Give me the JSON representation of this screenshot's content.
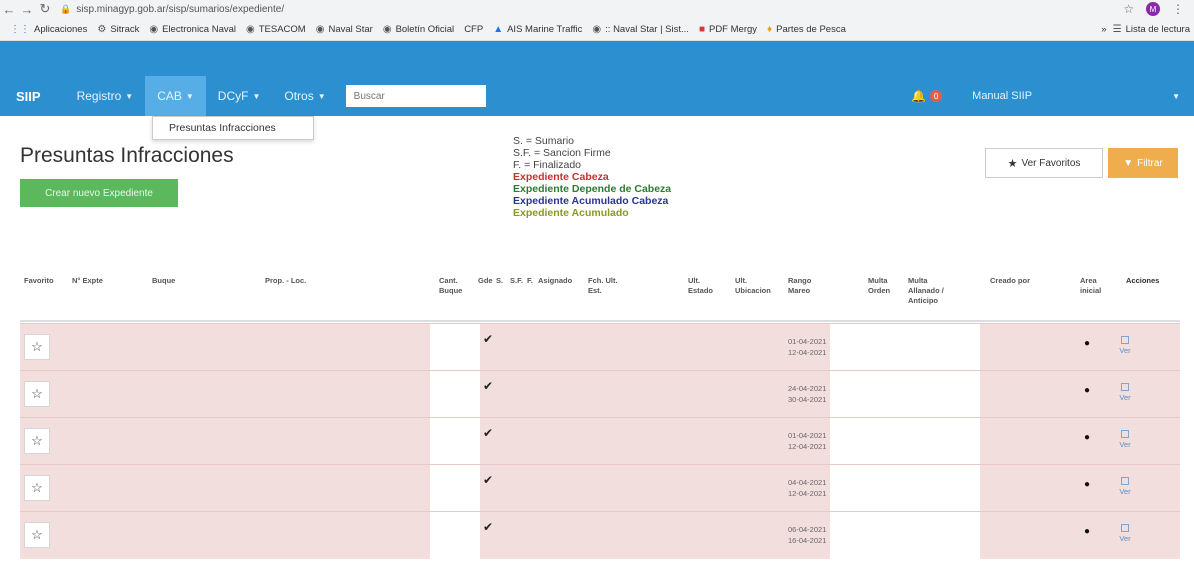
{
  "browser": {
    "url": "sisp.minagyp.gob.ar/sisp/sumarios/expediente/",
    "profile_initial": "M",
    "bookmarks": [
      "Aplicaciones",
      "Sitrack",
      "Electronica Naval",
      "TESACOM",
      "Naval Star",
      "Boletín Oficial",
      "CFP",
      "AIS Marine Traffic",
      ":: Naval Star | Sist...",
      "PDF Mergy",
      "Partes de Pesca"
    ],
    "reading_list": "Lista de lectura"
  },
  "navbar": {
    "brand": "SIIP",
    "menus": [
      "Registro",
      "CAB",
      "DCyF",
      "Otros"
    ],
    "search_placeholder": "Buscar",
    "notification_count": "0",
    "user_label": "Manual SIIP"
  },
  "dropdown": {
    "item": "Presuntas Infracciones"
  },
  "page": {
    "title": "Presuntas Infracciones",
    "create_button": "Crear nuevo Expediente",
    "favorites_button": "Ver Favoritos",
    "filter_button": "Filtrar"
  },
  "legend": {
    "sumario": "S. = Sumario",
    "sancion": "S.F. = Sancion Firme",
    "finalizado": "F. = Finalizado",
    "cabeza": "Expediente Cabeza",
    "depende": "Expediente Depende de Cabeza",
    "acumulado_cabeza": "Expediente Acumulado Cabeza",
    "acumulado": "Expediente Acumulado",
    "colors": {
      "cabeza": "#c9302c",
      "depende": "#2d7a32",
      "acumulado_cabeza": "#283593",
      "acumulado": "#8a9a20"
    }
  },
  "table": {
    "headers": {
      "favorito": "Favorito",
      "nro_expte": "N° Expte",
      "buque": "Buque",
      "prop_loc": "Prop. - Loc.",
      "cant_buque": "Cant. Buque",
      "gde": "Gde",
      "s": "S.",
      "sf": "S.F.",
      "f": "F.",
      "asignado": "Asignado",
      "fch_ult_est": "Fch. Ult. Est.",
      "ult_estado": "Ult. Estado",
      "ult_ubicacion": "Ult. Ubicacion",
      "rango_mareo": "Rango Mareo",
      "multa_orden": "Multa Orden",
      "multa_allanado": "Multa Allanado / Anticipo",
      "creado_por": "Creado por",
      "area_inicial": "Area inicial",
      "acciones": "Acciones"
    },
    "rows": [
      {
        "gde": "✔",
        "rango_start": "01-04-2021",
        "rango_end": "12-04-2021",
        "area": "●",
        "accion": "Ver"
      },
      {
        "gde": "✔",
        "rango_start": "24-04-2021",
        "rango_end": "30-04-2021",
        "area": "●",
        "accion": "Ver"
      },
      {
        "gde": "✔",
        "rango_start": "01-04-2021",
        "rango_end": "12-04-2021",
        "area": "●",
        "accion": "Ver"
      },
      {
        "gde": "✔",
        "rango_start": "04-04-2021",
        "rango_end": "12-04-2021",
        "area": "●",
        "accion": "Ver"
      },
      {
        "gde": "✔",
        "rango_start": "06-04-2021",
        "rango_end": "16-04-2021",
        "area": "●",
        "accion": "Ver"
      }
    ]
  }
}
